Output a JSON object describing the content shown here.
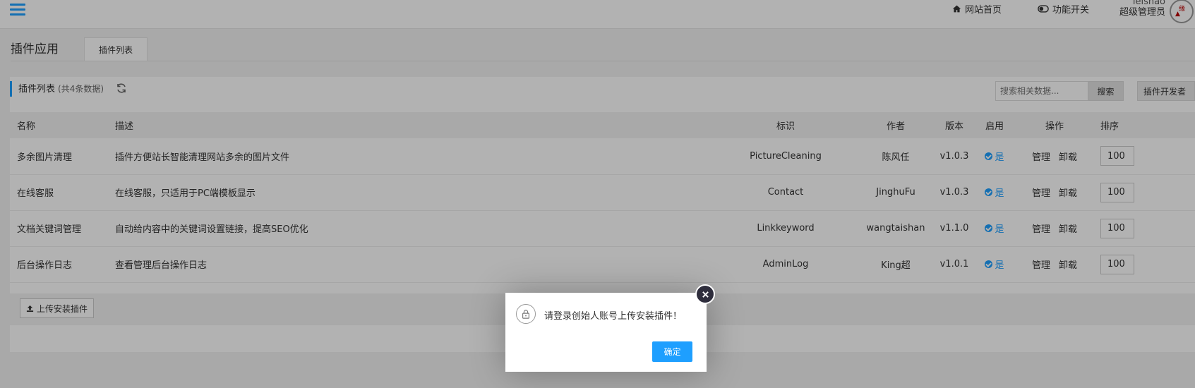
{
  "header": {
    "home_link": "网站首页",
    "toggle_link": "功能开关",
    "username": "leishao",
    "role": "超级管理员"
  },
  "page": {
    "title": "插件应用",
    "tab": "插件列表"
  },
  "list": {
    "title": "插件列表",
    "count_text": "(共4条数据)",
    "search_placeholder": "搜索相关数据...",
    "search_button": "搜索",
    "dev_button": "插件开发者"
  },
  "table": {
    "headers": {
      "name": "名称",
      "desc": "描述",
      "id": "标识",
      "author": "作者",
      "version": "版本",
      "enabled": "启用",
      "ops": "操作",
      "sort": "排序"
    },
    "op_manage": "管理",
    "op_uninstall": "卸载",
    "rows": [
      {
        "name": "多余图片清理",
        "desc": "插件方便站长智能清理网站多余的图片文件",
        "id": "PictureCleaning",
        "author": "陈风任",
        "version": "v1.0.3",
        "enabled": "是",
        "sort": "100"
      },
      {
        "name": "在线客服",
        "desc": "在线客服，只适用于PC端模板显示",
        "id": "Contact",
        "author": "JinghuFu",
        "version": "v1.0.3",
        "enabled": "是",
        "sort": "100"
      },
      {
        "name": "文档关键词管理",
        "desc": "自动给内容中的关键词设置链接，提高SEO优化",
        "id": "Linkkeyword",
        "author": "wangtaishan",
        "version": "v1.1.0",
        "enabled": "是",
        "sort": "100"
      },
      {
        "name": "后台操作日志",
        "desc": "查看管理后台操作日志",
        "id": "AdminLog",
        "author": "King超",
        "version": "v1.0.1",
        "enabled": "是",
        "sort": "100"
      }
    ]
  },
  "upload_button": "上传安装插件",
  "dialog": {
    "message": "请登录创始人账号上传安装插件！",
    "ok_button": "确定"
  },
  "colors": {
    "accent": "#1e9fff",
    "overlay": "rgba(0,0,0,0.3)"
  }
}
